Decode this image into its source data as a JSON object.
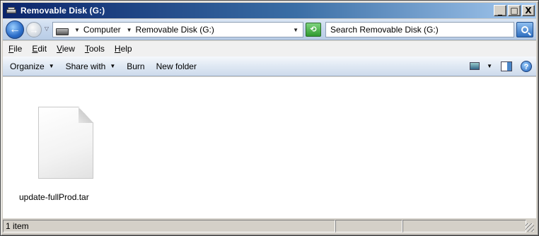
{
  "window": {
    "title": "Removable Disk (G:)",
    "controls": {
      "minimize": "_",
      "maximize": "□",
      "close": "X"
    }
  },
  "address": {
    "crumbs": [
      "Computer",
      "Removable Disk (G:)"
    ],
    "search_placeholder": "Search Removable Disk (G:)"
  },
  "menu": [
    "File",
    "Edit",
    "View",
    "Tools",
    "Help"
  ],
  "menu_underline": [
    "F",
    "E",
    "V",
    "T",
    "H"
  ],
  "commands": {
    "organize": "Organize",
    "share_with": "Share with",
    "burn": "Burn",
    "new_folder": "New folder"
  },
  "files": [
    {
      "name": "update-fullProd.tar",
      "icon": "document-icon"
    }
  ],
  "status": {
    "count": "1 item"
  },
  "colors": {
    "title_gradient_start": "#0a246a",
    "title_gradient_end": "#a6caf0",
    "content_bg": "#ffffff"
  }
}
